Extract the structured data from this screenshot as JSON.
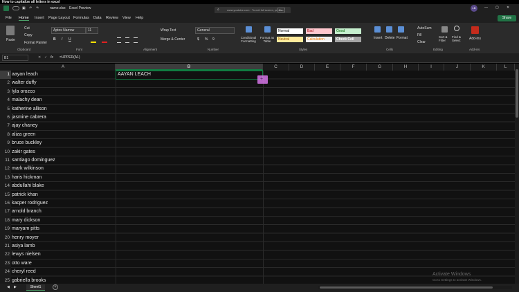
{
  "video_title": "How to capitalize all letters in excel",
  "title_bar": {
    "file": "name.xlsx",
    "separator": "·",
    "app_state": "Excel Preview",
    "address": "www.youtube.com · To exit full screen, press",
    "address_key": "Esc",
    "avatar": "LB"
  },
  "menu": [
    "File",
    "Home",
    "Insert",
    "Page Layout",
    "Formulas",
    "Data",
    "Review",
    "View",
    "Help"
  ],
  "share_label": "Share",
  "ribbon": {
    "clipboard": {
      "paste": "Paste",
      "cut": "Cut",
      "copy": "Copy",
      "format_painter": "Format Painter",
      "label": "Clipboard"
    },
    "font": {
      "name": "Aptos Narrow",
      "size": "11",
      "bold": "B",
      "italic": "I",
      "underline": "U",
      "label": "Font"
    },
    "alignment": {
      "wrap": "Wrap Text",
      "merge": "Merge & Center",
      "label": "Alignment"
    },
    "number": {
      "format": "General",
      "currency": "$",
      "percent": "%",
      "comma": "9",
      "label": "Number"
    },
    "styles": {
      "conditional": "Conditional Formatting",
      "format_table": "Format as Table",
      "normal": "Normal",
      "bad": "Bad",
      "good": "Good",
      "neutral": "Neutral",
      "calculation": "Calculation",
      "check_cell": "Check Cell",
      "label": "Styles"
    },
    "cells": {
      "insert": "Insert",
      "delete": "Delete",
      "format": "Format",
      "label": "Cells"
    },
    "editing": {
      "autosum": "AutoSum",
      "fill": "Fill",
      "clear": "Clear",
      "sort": "Sort & Filter",
      "find": "Find & Select",
      "label": "Editing"
    },
    "addins": {
      "addins": "Add-ins",
      "label": "Add-ins"
    }
  },
  "formula_bar": {
    "name_box": "B1",
    "fx": "fx",
    "formula": "=UPPER(A1)"
  },
  "columns": [
    "A",
    "B",
    "C",
    "D",
    "E",
    "F",
    "G",
    "H",
    "I",
    "J",
    "K",
    "L"
  ],
  "rows": [
    "1",
    "2",
    "3",
    "4",
    "5",
    "6",
    "7",
    "8",
    "9",
    "10",
    "11",
    "12",
    "13",
    "14",
    "15",
    "16",
    "17",
    "18",
    "19",
    "20",
    "21",
    "22",
    "23",
    "24",
    "25"
  ],
  "names": [
    "aayan leach",
    "walter duffy",
    "lyla orozco",
    "malachy dean",
    "katherine allison",
    "jasmine cabrera",
    "ajay chaney",
    "aliza green",
    "bruce buckley",
    "zakir gates",
    "santiago dominguez",
    "mark wilkinson",
    "haris hickman",
    "abdullahi blake",
    "patrick khan",
    "kacper rodriguez",
    "arnold branch",
    "mary dickson",
    "maryam pitts",
    "henry moyer",
    "asiya lamb",
    "lewys nielsen",
    "otto ware",
    "cheryl reed",
    "gabriella brooks"
  ],
  "b1_value": "AAYAN LEACH",
  "sheet_tab": "Sheet1",
  "watermark": {
    "line1": "Activate Windows",
    "line2": "Go to Settings to activate Windows."
  },
  "colors": {
    "accent_green": "#217346",
    "selection": "#107c41",
    "fill_handle": "#d675e8"
  }
}
